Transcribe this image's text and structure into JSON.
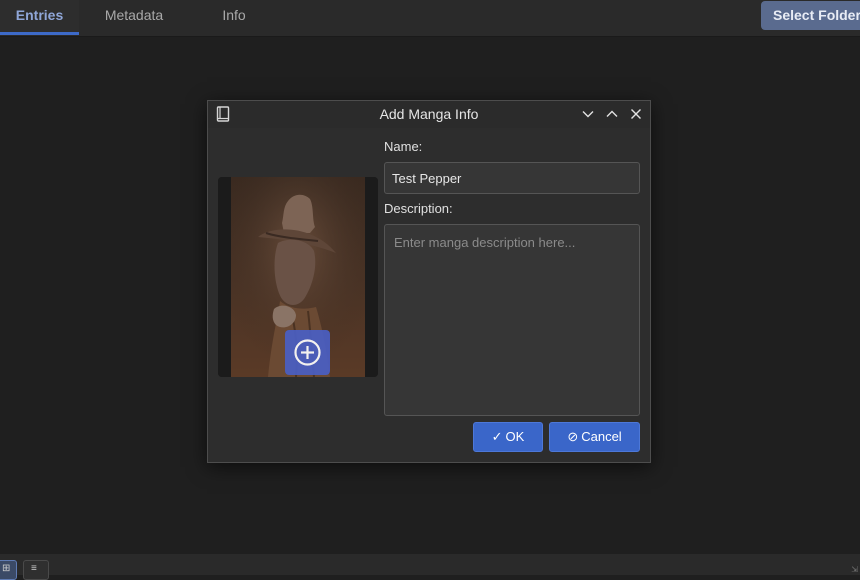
{
  "topbar": {
    "tabs": [
      {
        "label": "Entries",
        "active": true
      },
      {
        "label": "Metadata",
        "active": false
      },
      {
        "label": "Info",
        "active": false
      }
    ],
    "select_folder_label": "Select Folder"
  },
  "dialog": {
    "title": "Add Manga Info",
    "name_label": "Name:",
    "name_value": "Test Pepper",
    "description_label": "Description:",
    "description_placeholder": "Enter manga description here...",
    "description_value": "",
    "ok_label": "OK",
    "cancel_label": "Cancel",
    "ok_icon": "check-icon",
    "cancel_icon": "cancel-circle-icon",
    "add_cover_icon": "plus-circle-icon"
  },
  "bottombar": {
    "view_buttons": [
      "grid-view-icon",
      "list-view-icon"
    ]
  },
  "colors": {
    "accent": "#3a66c9",
    "active_tab": "#8fa6d8",
    "select_folder_bg": "#5a6b8f",
    "background": "#1f1f1f"
  }
}
